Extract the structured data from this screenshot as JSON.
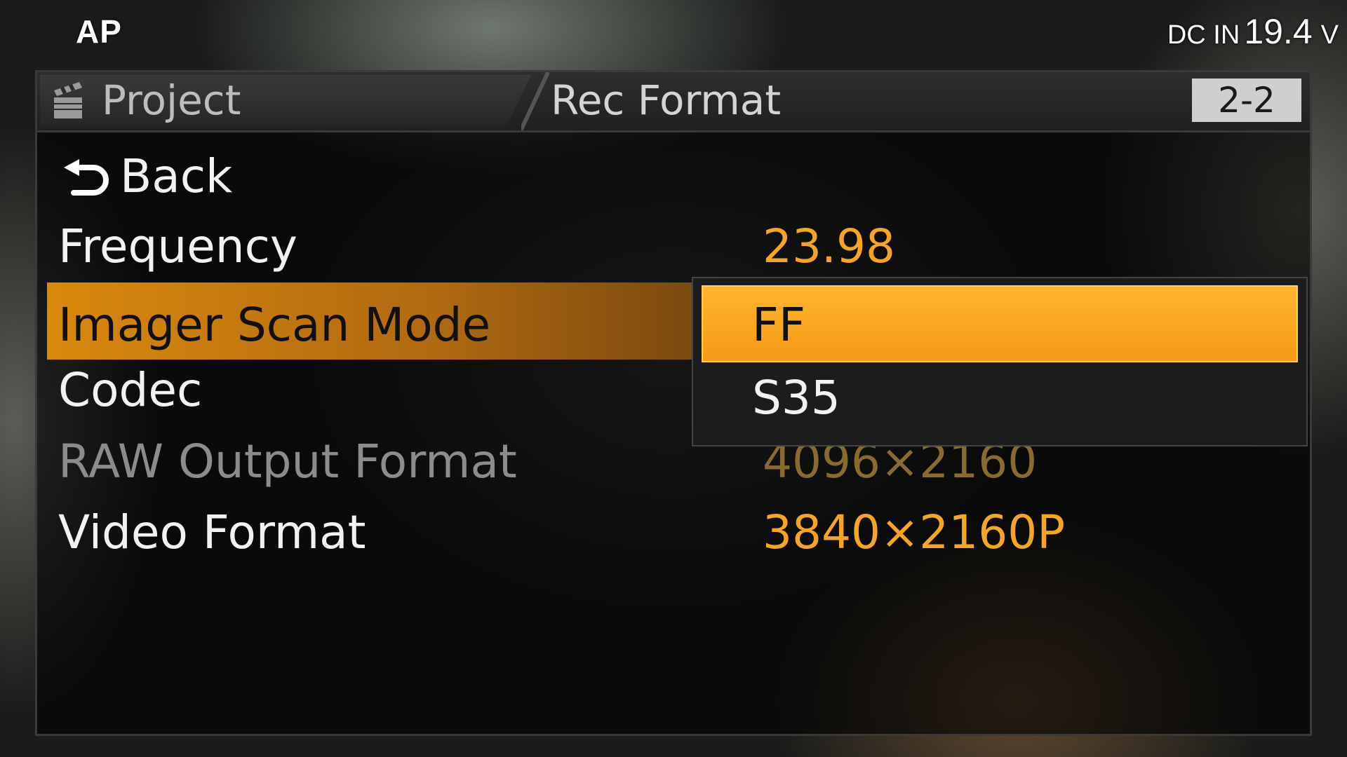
{
  "status": {
    "mode": "AP",
    "power_label": "DC IN",
    "power_value": "19.4",
    "power_unit": "V"
  },
  "header": {
    "tab_label": "Project",
    "tab_icon": "clapperboard-icon",
    "title": "Rec Format",
    "page": "2-2"
  },
  "menu": {
    "back_label": "Back",
    "back_icon": "back-arrow-icon",
    "items": [
      {
        "label": "Frequency",
        "value": "23.98"
      },
      {
        "label": "Imager Scan Mode",
        "value": ""
      },
      {
        "label": "Codec",
        "value": ""
      },
      {
        "label": "RAW Output Format",
        "value": "4096×2160"
      },
      {
        "label": "Video Format",
        "value": "3840×2160P"
      }
    ]
  },
  "dropdown": {
    "options": [
      "FF",
      "S35"
    ],
    "selected": "FF"
  },
  "colors": {
    "value_accent": "#f5a623",
    "highlight": "#ffb52e",
    "page_indicator_bg": "#cfcfcf"
  }
}
